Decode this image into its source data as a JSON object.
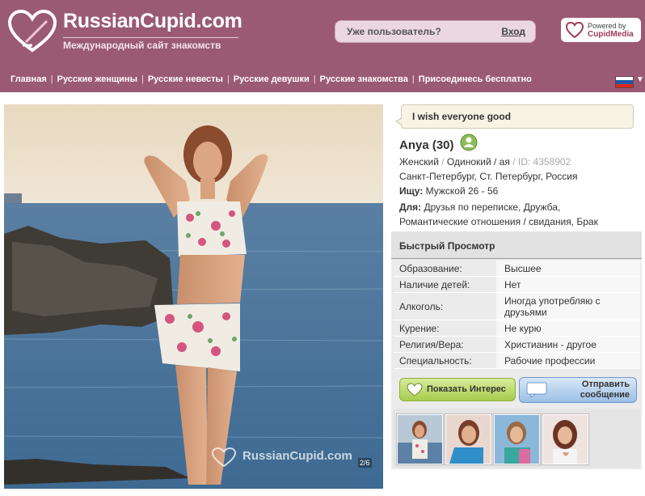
{
  "header": {
    "brand": "RussianCupid.com",
    "tagline": "Международный сайт знакомств",
    "login_prompt": "Уже пользователь?",
    "login_link": "Вход",
    "powered_by": "Powered by",
    "powered_brand": "CupidMedia",
    "colors": {
      "header_bg": "#9b5a73",
      "accent": "#9b3b5a"
    }
  },
  "nav": {
    "items": [
      "Главная",
      "Русские женщины",
      "Русские невесты",
      "Русские девушки",
      "Русские знакомства",
      "Присоединесь бесплатно"
    ],
    "language_flag": "russia-flag-icon"
  },
  "photo": {
    "watermark": "RussianCupid.com",
    "counter": "2/6"
  },
  "profile": {
    "headline": "I wish everyone good",
    "name_age": "Anya (30)",
    "gender": "Женский",
    "status": "Одинокий / ая",
    "id_label": "ID: 4358902",
    "location": "Санкт-Петербург, Ст. Петербург, Россия",
    "seeking_label": "Ищу:",
    "seeking_value": "Мужской 26 - 56",
    "for_label": "Для:",
    "for_value_1": "Друзья по переписке, Дружба,",
    "for_value_2": "Романтические отношения / свидания, Брак"
  },
  "quick_view": {
    "title": "Быстрый Просмотр",
    "rows": [
      {
        "label": "Образование:",
        "value": "Высшее"
      },
      {
        "label": "Наличие детей:",
        "value": "Нет"
      },
      {
        "label": "Алкоголь:",
        "value": "Иногда употребляю с друзьями"
      },
      {
        "label": "Курение:",
        "value": "Не курю"
      },
      {
        "label": "Религия/Вера:",
        "value": "Христианин - другое"
      },
      {
        "label": "Специальность:",
        "value": "Рабочие профессии"
      }
    ]
  },
  "actions": {
    "interest_label": "Показать Интерес",
    "message_line1": "Отправить",
    "message_line2": "сообщение"
  }
}
